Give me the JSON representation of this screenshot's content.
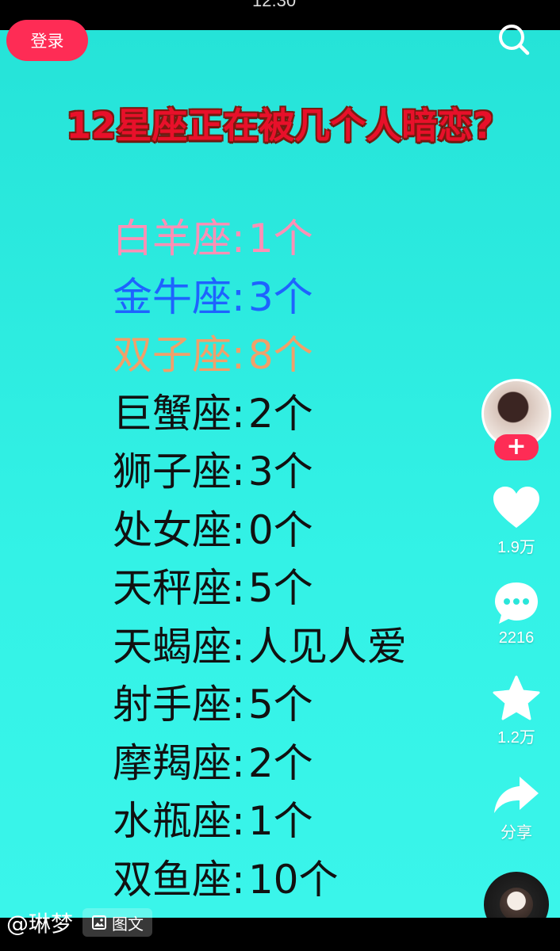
{
  "status_bar": {
    "time": "12:30"
  },
  "header": {
    "login_label": "登录",
    "search_icon": "search-icon"
  },
  "post": {
    "title": "12星座正在被几个人暗恋?",
    "signs": [
      {
        "name": "白羊座",
        "sep": ":",
        "count": "1个",
        "color": "#ff8fb5"
      },
      {
        "name": "金牛座",
        "sep": ":",
        "count": "3个",
        "color": "#1e63ff"
      },
      {
        "name": "双子座",
        "sep": ":",
        "count": "8个",
        "color": "#f0a06a"
      },
      {
        "name": "巨蟹座",
        "sep": ":",
        "count": "2个",
        "color": "#111111"
      },
      {
        "name": "狮子座",
        "sep": ":",
        "count": "3个",
        "color": "#111111"
      },
      {
        "name": "处女座",
        "sep": ":",
        "count": "0个",
        "color": "#111111"
      },
      {
        "name": "天秤座",
        "sep": ":",
        "count": "5个",
        "color": "#111111"
      },
      {
        "name": "天蝎座",
        "sep": ":",
        "count": "人见人爱",
        "color": "#111111"
      },
      {
        "name": "射手座",
        "sep": ":",
        "count": "5个",
        "color": "#111111"
      },
      {
        "name": "摩羯座",
        "sep": ":",
        "count": "2个",
        "color": "#111111"
      },
      {
        "name": "水瓶座",
        "sep": ":",
        "count": "1个",
        "color": "#111111"
      },
      {
        "name": "双鱼座",
        "sep": ":",
        "count": "10个",
        "color": "#111111"
      }
    ]
  },
  "sidebar": {
    "follow_label": "+",
    "like_count": "1.9万",
    "comment_count": "2216",
    "favorite_count": "1.2万",
    "share_label": "分享"
  },
  "footer": {
    "author": "@琳梦",
    "tag_label": "图文"
  }
}
